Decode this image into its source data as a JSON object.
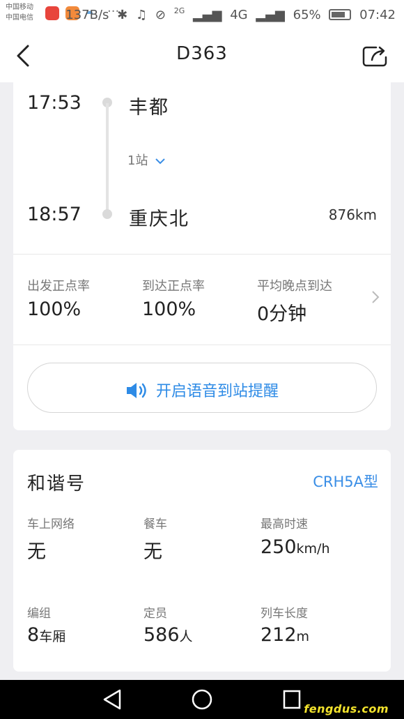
{
  "status_bar": {
    "carrier_1": "中国移动",
    "carrier_2": "中国电信",
    "net_speed": "137B/s",
    "signal_1": "2G",
    "signal_2": "4G",
    "battery": "65%",
    "time": "07:42"
  },
  "header": {
    "title": "D363",
    "back_icon": "chevron-left-icon",
    "share_icon": "share-icon"
  },
  "route": {
    "depart_time": "17:53",
    "depart_station": "丰都",
    "stops_label": "1站",
    "arrive_time": "18:57",
    "arrive_station": "重庆北",
    "distance": "876km"
  },
  "punctuality": {
    "items": [
      {
        "label": "出发正点率",
        "value": "100%"
      },
      {
        "label": "到达正点率",
        "value": "100%"
      },
      {
        "label": "平均晚点到达",
        "value": "0分钟"
      }
    ]
  },
  "voice_reminder": {
    "label": "开启语音到站提醒",
    "color": "#2e8be6"
  },
  "train": {
    "name": "和谐号",
    "model": "CRH5A型",
    "facts": [
      {
        "label": "车上网络",
        "value": "无",
        "unit": ""
      },
      {
        "label": "餐车",
        "value": "无",
        "unit": ""
      },
      {
        "label": "最高时速",
        "value": "250",
        "unit": "km/h"
      },
      {
        "label": "编组",
        "value": "8",
        "unit": "车厢"
      },
      {
        "label": "定员",
        "value": "586",
        "unit": "人"
      },
      {
        "label": "列车长度",
        "value": "212",
        "unit": "m"
      }
    ]
  },
  "watermark": "fengdus.com"
}
